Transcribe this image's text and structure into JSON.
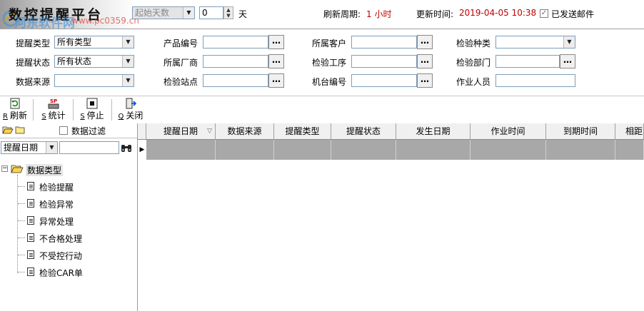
{
  "app": {
    "title": "数控提醒平台",
    "watermark": "河东软件网",
    "watermark_sub": "www.pc0359.cn"
  },
  "header": {
    "start_days_select": "起始天数",
    "days_value": "0",
    "days_unit": "天",
    "refresh_cycle_label": "刷新周期:",
    "refresh_cycle_value": "1 小时",
    "update_time_label": "更新时间:",
    "update_time_value": "2019-04-05 10:38",
    "email_sent_label": "已发送邮件",
    "email_sent_checked": "✓"
  },
  "filters": {
    "reminder_type_label": "提醒类型",
    "reminder_type_value": "所有类型",
    "reminder_status_label": "提醒状态",
    "reminder_status_value": "所有状态",
    "data_source_label": "数据来源",
    "data_source_value": "",
    "product_no_label": "产品编号",
    "manufacturer_label": "所属厂商",
    "inspect_station_label": "检验站点",
    "customer_label": "所属客户",
    "inspect_process_label": "检验工序",
    "machine_no_label": "机台编号",
    "inspect_type_label": "检验种类",
    "inspect_dept_label": "检验部门",
    "operator_label": "作业人员",
    "dots": "…"
  },
  "toolbar": {
    "refresh": {
      "key": "R",
      "label": "刷新"
    },
    "stats": {
      "key": "S",
      "label": "统计"
    },
    "stop": {
      "key": "S",
      "label": "停止"
    },
    "close": {
      "key": "Q",
      "label": "关闭"
    }
  },
  "left_panel": {
    "data_filter_label": "数据过滤",
    "sort_field_value": "提醒日期",
    "tree_root": "数据类型",
    "tree_items": [
      "检验提醒",
      "检验异常",
      "异常处理",
      "不合格处理",
      "不受控行动",
      "检验CAR单"
    ]
  },
  "grid": {
    "columns": [
      "提醒日期",
      "数据来源",
      "提醒类型",
      "提醒状态",
      "发生日期",
      "作业时间",
      "到期时间",
      "相距时"
    ],
    "sort_marker": "▽",
    "row_indicator": "▶"
  },
  "colors": {
    "accent_red": "#c00000",
    "selected_row": "#a8a8a8",
    "header_bg": "#f0f0f0"
  },
  "icons": {
    "refresh": "refresh-icon",
    "stats": "sp-stats-icon",
    "stop": "stop-icon",
    "close": "exit-icon",
    "folder_open": "folder-open-icon",
    "folder": "folder-icon",
    "binoculars": "binoculars-icon",
    "document": "document-icon"
  }
}
